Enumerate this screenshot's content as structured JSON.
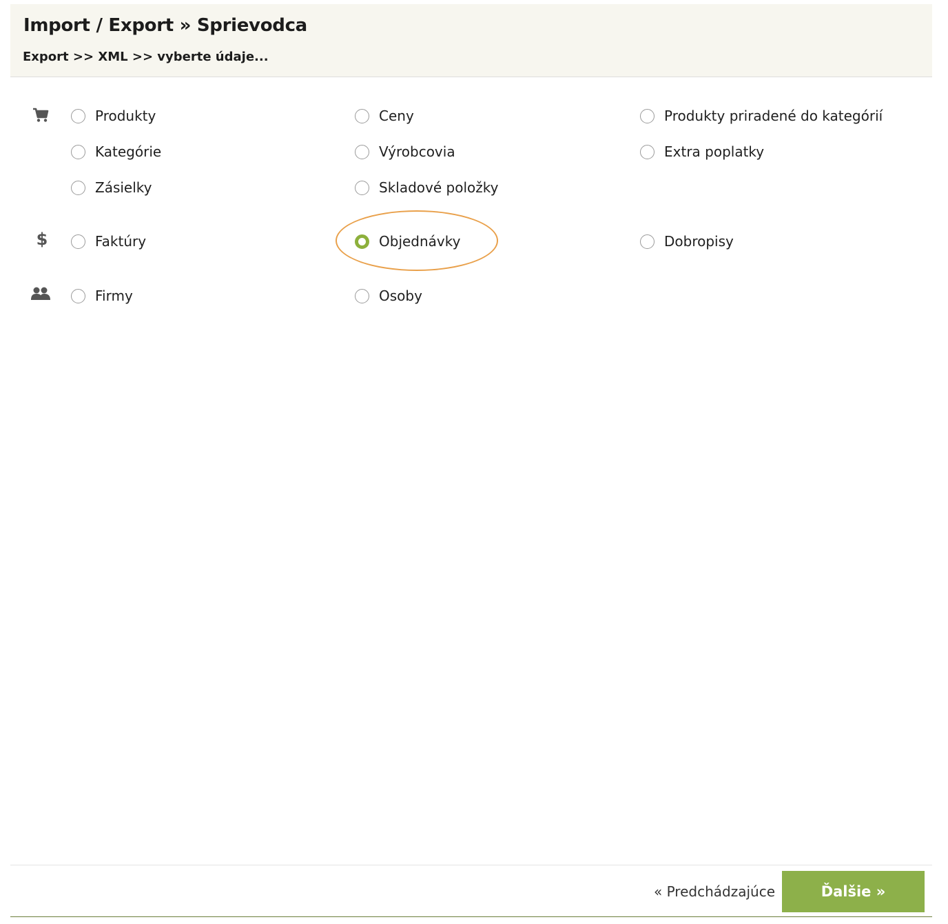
{
  "header": {
    "title": "Import / Export » Sprievodca",
    "breadcrumb": "Export >> XML >> vyberte údaje..."
  },
  "groups": [
    {
      "icon": "cart-icon"
    },
    {
      "icon": "dollar-icon",
      "symbol": "$"
    },
    {
      "icon": "people-icon"
    }
  ],
  "options": {
    "produkty": "Produkty",
    "ceny": "Ceny",
    "produkty_kategorie": "Produkty priradené do kategórií",
    "kategorie": "Kategórie",
    "vyrobcovia": "Výrobcovia",
    "extra_poplatky": "Extra poplatky",
    "zasielky": "Zásielky",
    "skladove_polozky": "Skladové položky",
    "faktury": "Faktúry",
    "objednavky": "Objednávky",
    "dobropisy": "Dobropisy",
    "firmy": "Firmy",
    "osoby": "Osoby"
  },
  "selected_option": "Objednávky",
  "colors": {
    "accent": "#8db04a",
    "highlight": "#e9a04a",
    "header_bg": "#f7f6ef"
  },
  "footer": {
    "prev_label": "« Predchádzajúce",
    "next_label": "Ďalšie »"
  }
}
